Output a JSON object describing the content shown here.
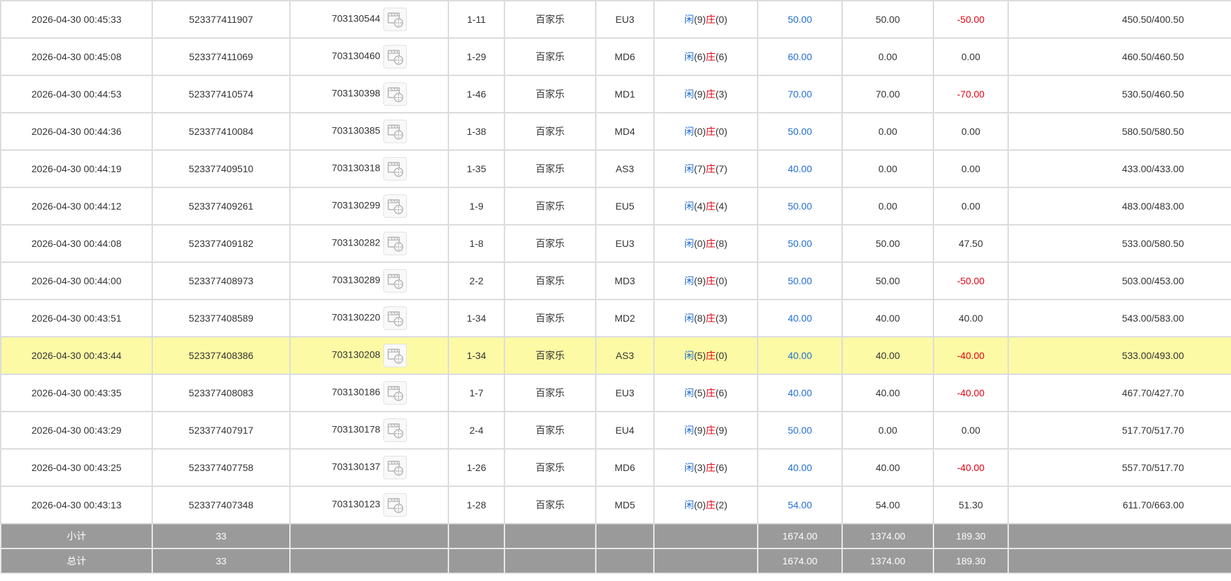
{
  "table": {
    "rows": [
      {
        "time": "2026-04-30 00:45:33",
        "order": "523377411907",
        "round": "703130544",
        "shoe": "1-11",
        "game": "百家乐",
        "table": "EU3",
        "player_label": "闲",
        "player_score": "(9)",
        "banker_label": "庄",
        "banker_score": "(0)",
        "bet": "50.00",
        "valid": "50.00",
        "win": "-50.00",
        "win_neg": true,
        "balance": "450.50/400.50"
      },
      {
        "time": "2026-04-30 00:45:08",
        "order": "523377411069",
        "round": "703130460",
        "shoe": "1-29",
        "game": "百家乐",
        "table": "MD6",
        "player_label": "闲",
        "player_score": "(6)",
        "banker_label": "庄",
        "banker_score": "(6)",
        "bet": "60.00",
        "valid": "0.00",
        "win": "0.00",
        "win_neg": false,
        "balance": "460.50/460.50"
      },
      {
        "time": "2026-04-30 00:44:53",
        "order": "523377410574",
        "round": "703130398",
        "shoe": "1-46",
        "game": "百家乐",
        "table": "MD1",
        "player_label": "闲",
        "player_score": "(9)",
        "banker_label": "庄",
        "banker_score": "(3)",
        "bet": "70.00",
        "valid": "70.00",
        "win": "-70.00",
        "win_neg": true,
        "balance": "530.50/460.50"
      },
      {
        "time": "2026-04-30 00:44:36",
        "order": "523377410084",
        "round": "703130385",
        "shoe": "1-38",
        "game": "百家乐",
        "table": "MD4",
        "player_label": "闲",
        "player_score": "(0)",
        "banker_label": "庄",
        "banker_score": "(0)",
        "bet": "50.00",
        "valid": "0.00",
        "win": "0.00",
        "win_neg": false,
        "balance": "580.50/580.50"
      },
      {
        "time": "2026-04-30 00:44:19",
        "order": "523377409510",
        "round": "703130318",
        "shoe": "1-35",
        "game": "百家乐",
        "table": "AS3",
        "player_label": "闲",
        "player_score": "(7)",
        "banker_label": "庄",
        "banker_score": "(7)",
        "bet": "40.00",
        "valid": "0.00",
        "win": "0.00",
        "win_neg": false,
        "balance": "433.00/433.00"
      },
      {
        "time": "2026-04-30 00:44:12",
        "order": "523377409261",
        "round": "703130299",
        "shoe": "1-9",
        "game": "百家乐",
        "table": "EU5",
        "player_label": "闲",
        "player_score": "(4)",
        "banker_label": "庄",
        "banker_score": "(4)",
        "bet": "50.00",
        "valid": "0.00",
        "win": "0.00",
        "win_neg": false,
        "balance": "483.00/483.00"
      },
      {
        "time": "2026-04-30 00:44:08",
        "order": "523377409182",
        "round": "703130282",
        "shoe": "1-8",
        "game": "百家乐",
        "table": "EU3",
        "player_label": "闲",
        "player_score": "(0)",
        "banker_label": "庄",
        "banker_score": "(8)",
        "bet": "50.00",
        "valid": "50.00",
        "win": "47.50",
        "win_neg": false,
        "balance": "533.00/580.50"
      },
      {
        "time": "2026-04-30 00:44:00",
        "order": "523377408973",
        "round": "703130289",
        "shoe": "2-2",
        "game": "百家乐",
        "table": "MD3",
        "player_label": "闲",
        "player_score": "(9)",
        "banker_label": "庄",
        "banker_score": "(0)",
        "bet": "50.00",
        "valid": "50.00",
        "win": "-50.00",
        "win_neg": true,
        "balance": "503.00/453.00"
      },
      {
        "time": "2026-04-30 00:43:51",
        "order": "523377408589",
        "round": "703130220",
        "shoe": "1-34",
        "game": "百家乐",
        "table": "MD2",
        "player_label": "闲",
        "player_score": "(8)",
        "banker_label": "庄",
        "banker_score": "(3)",
        "bet": "40.00",
        "valid": "40.00",
        "win": "40.00",
        "win_neg": false,
        "balance": "543.00/583.00"
      },
      {
        "time": "2026-04-30 00:43:44",
        "order": "523377408386",
        "round": "703130208",
        "shoe": "1-34",
        "game": "百家乐",
        "table": "AS3",
        "player_label": "闲",
        "player_score": "(5)",
        "banker_label": "庄",
        "banker_score": "(0)",
        "bet": "40.00",
        "valid": "40.00",
        "win": "-40.00",
        "win_neg": true,
        "balance": "533.00/493.00",
        "highlight": true
      },
      {
        "time": "2026-04-30 00:43:35",
        "order": "523377408083",
        "round": "703130186",
        "shoe": "1-7",
        "game": "百家乐",
        "table": "EU3",
        "player_label": "闲",
        "player_score": "(5)",
        "banker_label": "庄",
        "banker_score": "(6)",
        "bet": "40.00",
        "valid": "40.00",
        "win": "-40.00",
        "win_neg": true,
        "balance": "467.70/427.70"
      },
      {
        "time": "2026-04-30 00:43:29",
        "order": "523377407917",
        "round": "703130178",
        "shoe": "2-4",
        "game": "百家乐",
        "table": "EU4",
        "player_label": "闲",
        "player_score": "(9)",
        "banker_label": "庄",
        "banker_score": "(9)",
        "bet": "50.00",
        "valid": "0.00",
        "win": "0.00",
        "win_neg": false,
        "balance": "517.70/517.70"
      },
      {
        "time": "2026-04-30 00:43:25",
        "order": "523377407758",
        "round": "703130137",
        "shoe": "1-26",
        "game": "百家乐",
        "table": "MD6",
        "player_label": "闲",
        "player_score": "(3)",
        "banker_label": "庄",
        "banker_score": "(6)",
        "bet": "40.00",
        "valid": "40.00",
        "win": "-40.00",
        "win_neg": true,
        "balance": "557.70/517.70"
      },
      {
        "time": "2026-04-30 00:43:13",
        "order": "523377407348",
        "round": "703130123",
        "shoe": "1-28",
        "game": "百家乐",
        "table": "MD5",
        "player_label": "闲",
        "player_score": "(0)",
        "banker_label": "庄",
        "banker_score": "(2)",
        "bet": "54.00",
        "valid": "54.00",
        "win": "51.30",
        "win_neg": false,
        "balance": "611.70/663.00"
      }
    ],
    "subtotal": {
      "label": "小计",
      "count": "33",
      "bet": "1674.00",
      "valid": "1374.00",
      "win": "189.30"
    },
    "total": {
      "label": "总计",
      "count": "33",
      "bet": "1674.00",
      "valid": "1374.00",
      "win": "189.30"
    }
  },
  "colors": {
    "player": "#1f6ed4",
    "banker": "#e60012",
    "highlight": "#fdfaa5",
    "summary_bg": "#9a9a9a"
  },
  "icons": {
    "video": "video-replay-icon"
  }
}
